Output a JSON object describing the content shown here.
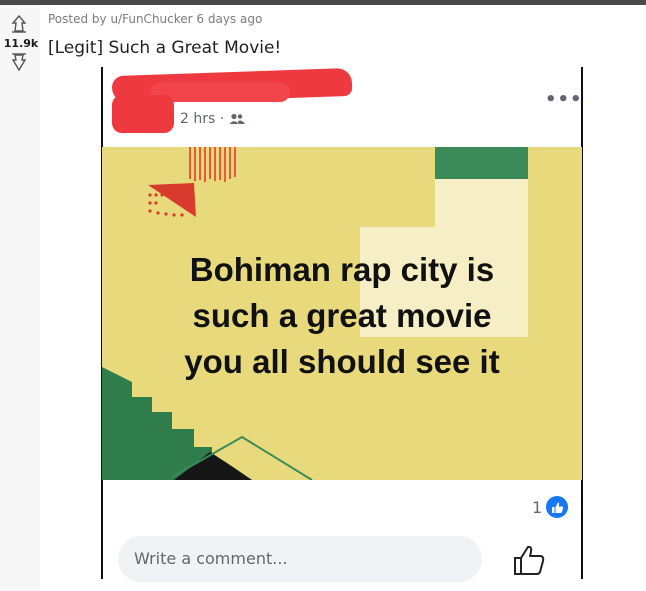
{
  "post": {
    "score": "11.9k",
    "posted_by": "Posted by u/FunChucker 6 days ago",
    "title": "[Legit] Such a Great Movie!"
  },
  "embed": {
    "time": "2 hrs ·",
    "image_text_lines": [
      "Bohiman rap city is",
      "such a great movie",
      "you all should see it"
    ],
    "like_count": "1",
    "comment_placeholder": "Write a comment..."
  },
  "colors": {
    "image_bg": "#e8d97c",
    "redaction": "#ef3940",
    "fb_blue": "#1877f2"
  },
  "icons": [
    "upvote-icon",
    "downvote-icon",
    "more-options-icon",
    "friends-icon",
    "like-badge-icon",
    "thumbs-up-icon"
  ]
}
